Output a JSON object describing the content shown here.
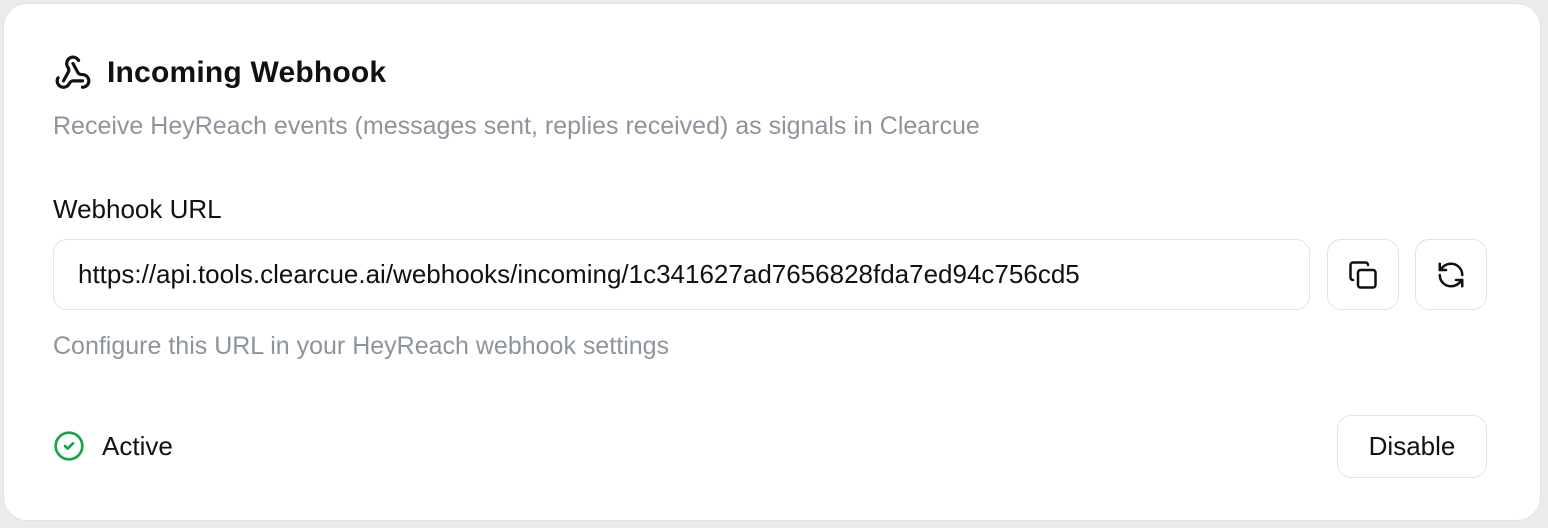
{
  "card": {
    "title": "Incoming Webhook",
    "title_icon": "webhook-icon",
    "subtitle": "Receive HeyReach events (messages sent, replies received) as signals in Clearcue"
  },
  "webhook_url": {
    "label": "Webhook URL",
    "value": "https://api.tools.clearcue.ai/webhooks/incoming/1c341627ad7656828fda7ed94c756cd5",
    "helper": "Configure this URL in your HeyReach webhook settings",
    "actions": [
      {
        "icon": "copy-icon"
      },
      {
        "icon": "refresh-icon"
      }
    ]
  },
  "status": {
    "label": "Active",
    "icon": "check-circle-icon",
    "color": "#16a34a"
  },
  "disable_button": {
    "label": "Disable"
  }
}
